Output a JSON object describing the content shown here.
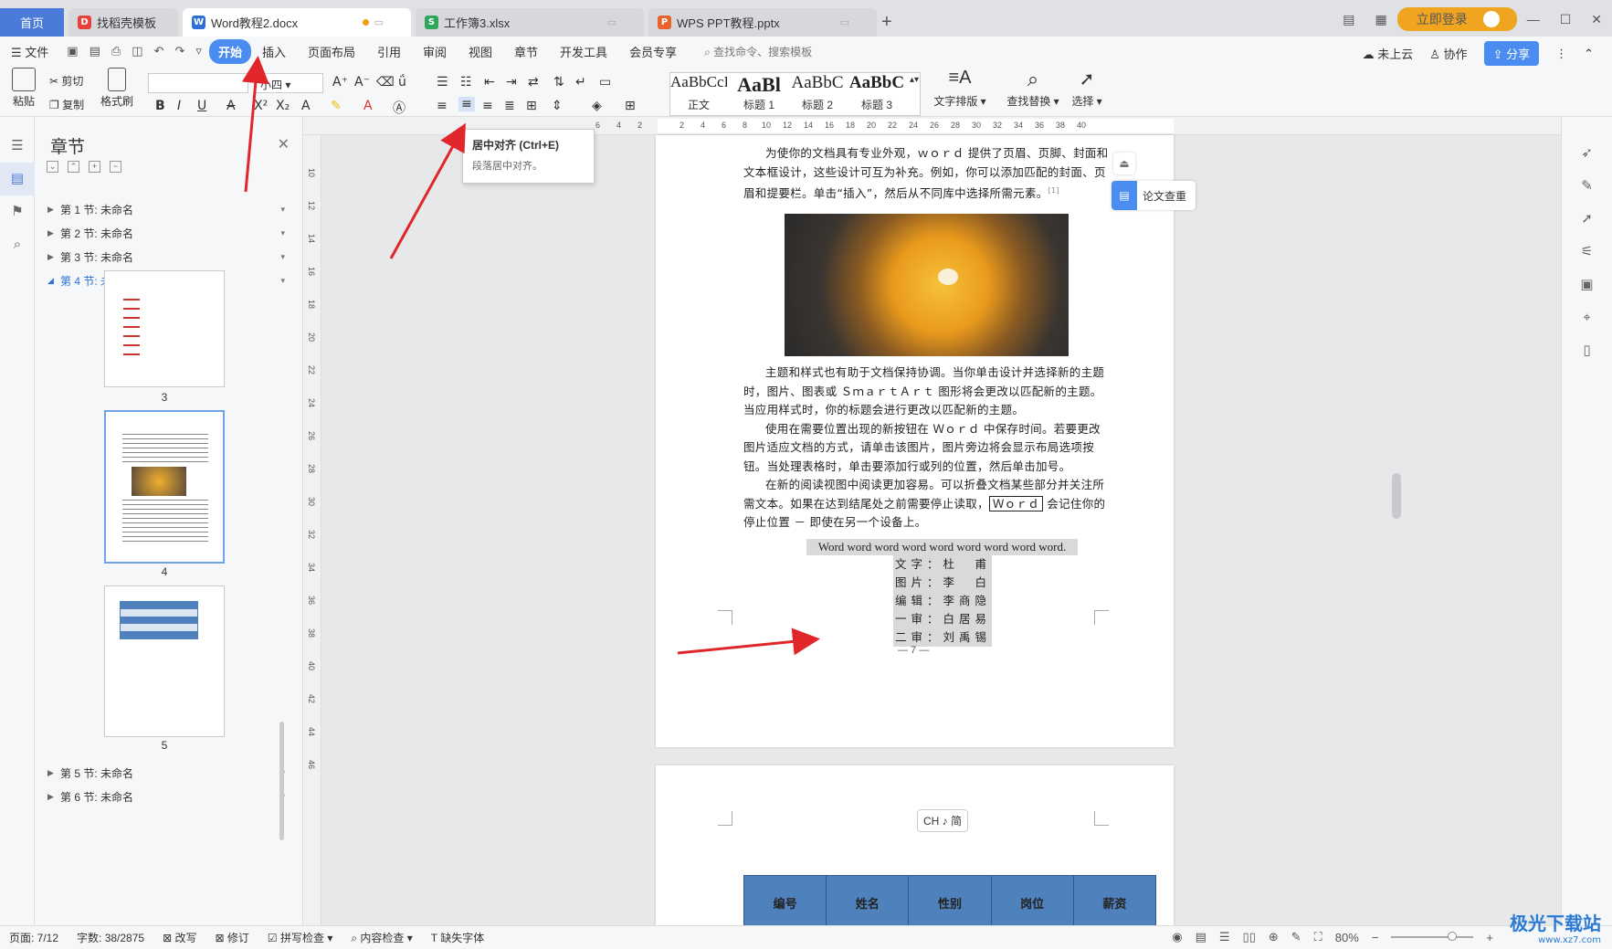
{
  "tabs": {
    "home": "首页",
    "items": [
      {
        "label": "找稻壳模板",
        "icon": "docer-icon"
      },
      {
        "label": "Word教程2.docx",
        "icon": "word-icon"
      },
      {
        "label": "工作簿3.xlsx",
        "icon": "excel-icon"
      },
      {
        "label": "WPS PPT教程.pptx",
        "icon": "ppt-icon"
      }
    ],
    "new_tab": "+",
    "login": "立即登录"
  },
  "menu": {
    "file": "文件",
    "items": [
      "开始",
      "插入",
      "页面布局",
      "引用",
      "审阅",
      "视图",
      "章节",
      "开发工具",
      "会员专享"
    ],
    "search": "查找命令、搜索模板",
    "cloud": "未上云",
    "collab": "协作",
    "share": "分享"
  },
  "ribbon": {
    "paste": "粘贴",
    "cut": "剪切",
    "copy": "复制",
    "format_painter": "格式刷",
    "font_name": "",
    "font_size": "小四",
    "styles": [
      {
        "sample": "AaBbCcI",
        "name": "正文"
      },
      {
        "sample": "AaBl",
        "name": "标题 1"
      },
      {
        "sample": "AaBbC",
        "name": "标题 2"
      },
      {
        "sample": "AaBbC",
        "name": "标题 3"
      }
    ],
    "text_layout": "文字排版",
    "find_replace": "查找替换",
    "select": "选择"
  },
  "tooltip": {
    "title": "居中对齐 (Ctrl+E)",
    "desc": "段落居中对齐。"
  },
  "panel": {
    "title": "章节",
    "sections": [
      {
        "label": "第 1 节: 未命名"
      },
      {
        "label": "第 2 节: 未命名"
      },
      {
        "label": "第 3 节: 未命名"
      },
      {
        "label": "第 4 节: 未命名"
      },
      {
        "label": "第 5 节: 未命名"
      },
      {
        "label": "第 6 节: 未命名"
      }
    ],
    "pages": [
      "3",
      "4",
      "5"
    ]
  },
  "ruler": {
    "h": [
      "6",
      "4",
      "2",
      "2",
      "4",
      "6",
      "8",
      "10",
      "12",
      "14",
      "16",
      "18",
      "20",
      "22",
      "24",
      "26",
      "28",
      "30",
      "32",
      "34",
      "36",
      "38",
      "40"
    ],
    "v": [
      "10",
      "12",
      "14",
      "16",
      "18",
      "20",
      "22",
      "24",
      "26",
      "28",
      "30",
      "32",
      "34",
      "36",
      "38",
      "40",
      "42",
      "44",
      "46"
    ]
  },
  "document": {
    "para1": "为使你的文档具有专业外观，ｗｏｒｄ 提供了页眉、页脚、封面和文本框设计，这些设计可互为补充。例如，你可以添加匹配的封面、页眉和提要栏。单击“插入”，然后从不同库中选择所需元素。",
    "footnote_ref": "[1]",
    "para2": "主题和样式也有助于文档保持协调。当你单击设计并选择新的主题时，图片、图表或 ＳｍａｒｔＡｒｔ 图形将会更改以匹配新的主题。当应用样式时，你的标题会进行更改以匹配新的主题。",
    "para3": "使用在需要位置出现的新按钮在 Ｗｏｒｄ 中保存时间。若要更改图片适应文档的方式，请单击该图片，图片旁边将会显示布局选项按钮。当处理表格时，单击要添加行或列的位置，然后单击加号。",
    "para4_a": "在新的阅读视图中阅读更加容易。可以折叠文档某些部分并关注所需文本。如果在达到结尾处之前需要停止读取，",
    "para4_box": "Ｗｏｒｄ",
    "para4_b": " 会记住你的停止位置 － 即使在另一个设备上。",
    "word_line": "Word word word word word word word word word.",
    "credits": [
      "文字：杜　甫",
      "图片：李　白",
      "编辑：李商隐",
      "一审：白居易",
      "二审：刘禹锡"
    ],
    "page_number": "— 7 —",
    "table_headers": [
      "编号",
      "姓名",
      "性别",
      "岗位",
      "薪资"
    ],
    "thesis_check": "论文查重"
  },
  "ime": "CH ♪ 简",
  "status": {
    "page": "页面: 7/12",
    "words": "字数: 38/2875",
    "rewrite": "改写",
    "revise": "修订",
    "spell": "拼写检查",
    "content": "内容检查",
    "missing_font": "缺失字体",
    "zoom": "80%"
  },
  "watermark": {
    "title": "极光下载站",
    "url": "www.xz7.com"
  },
  "colors": {
    "accent": "#4a8cf0",
    "home_tab": "#4a7bd8",
    "table_header": "#4f81bd",
    "arrow": "#e0262a"
  }
}
